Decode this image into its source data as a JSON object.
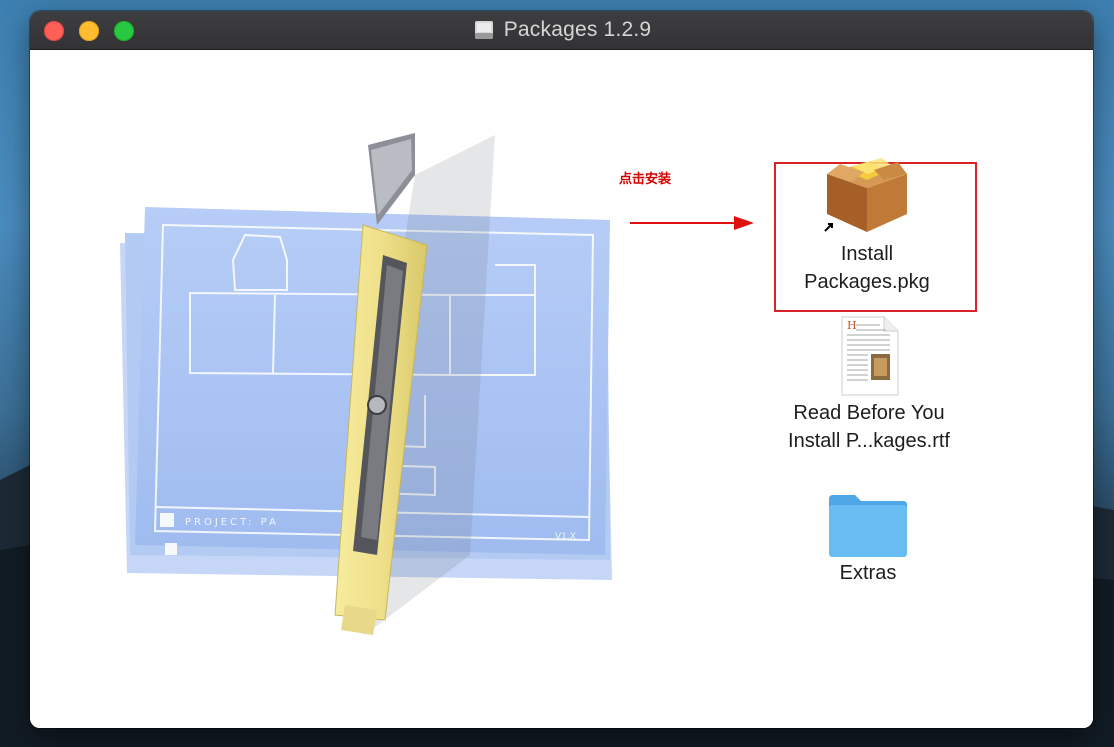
{
  "desktop": {
    "wallpaper": "mountain-landscape"
  },
  "window": {
    "title": "Packages 1.2.9",
    "title_icon": "disk-image-icon",
    "controls": [
      "close",
      "minimize",
      "zoom"
    ]
  },
  "annotation": {
    "text": "点击安装",
    "color": "#d40000"
  },
  "items": {
    "installer": {
      "label_line1": "Install",
      "label_line2": "Packages.pkg",
      "icon": "package-box-icon",
      "alias": true
    },
    "readme": {
      "label_line1": "Read Before You",
      "label_line2": "Install P...kages.rtf",
      "icon": "rtf-document-icon"
    },
    "extras": {
      "label": "Extras",
      "icon": "folder-icon"
    }
  },
  "colors": {
    "highlight": "#d8232a",
    "folder": "#5ab4f0",
    "blueprint": "#a9c4f5",
    "cutter": "#f3e79a"
  }
}
